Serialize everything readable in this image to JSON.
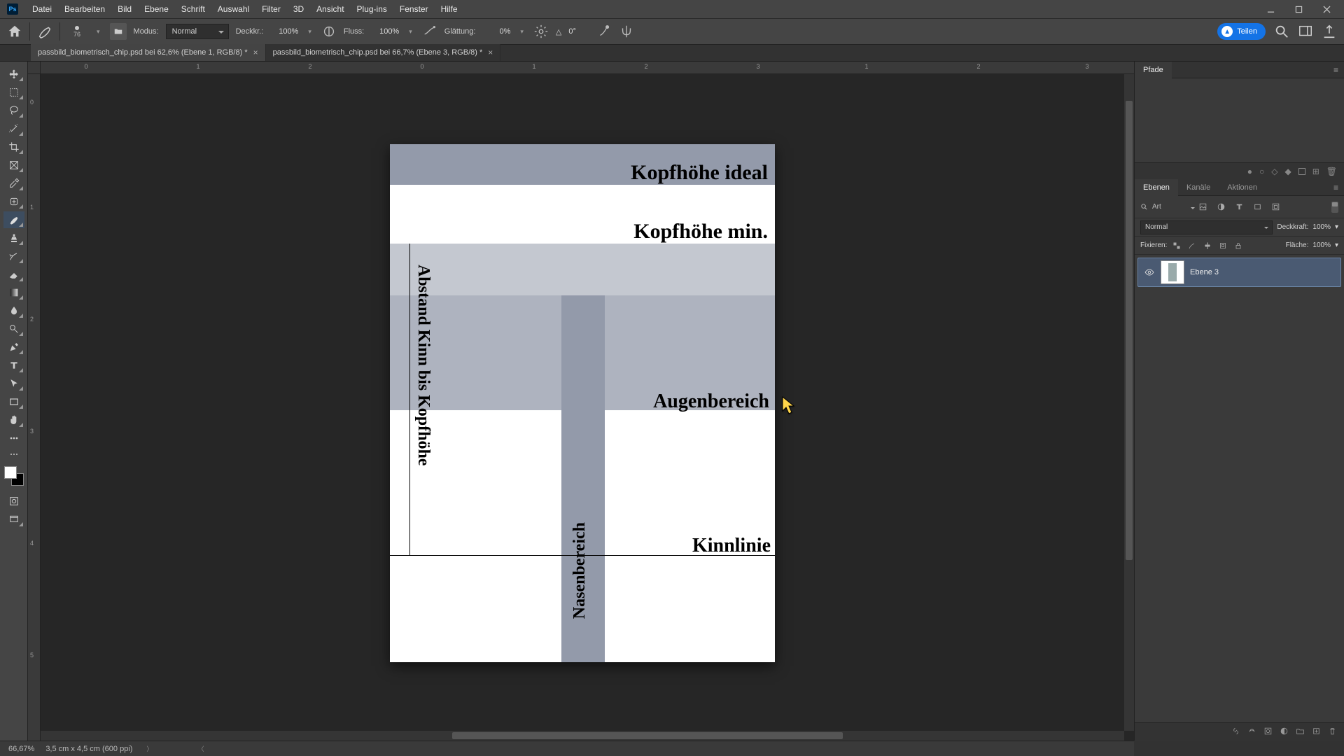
{
  "menu": {
    "items": [
      "Datei",
      "Bearbeiten",
      "Bild",
      "Ebene",
      "Schrift",
      "Auswahl",
      "Filter",
      "3D",
      "Ansicht",
      "Plug-ins",
      "Fenster",
      "Hilfe"
    ]
  },
  "options": {
    "brush_size": "76",
    "mode_label": "Modus:",
    "mode_value": "Normal",
    "opacity_label": "Deckkr.:",
    "opacity_value": "100%",
    "flow_label": "Fluss:",
    "flow_value": "100%",
    "smoothing_label": "Glättung:",
    "smoothing_value": "0%",
    "angle_icon_label": "△",
    "angle_value": "0°",
    "share_label": "Teilen"
  },
  "tabs": [
    {
      "title": "passbild_biometrisch_chip.psd bei 62,6% (Ebene 1, RGB/8) *",
      "active": false
    },
    {
      "title": "passbild_biometrisch_chip.psd bei 66,7% (Ebene 3, RGB/8) *",
      "active": true
    }
  ],
  "ruler_h": [
    {
      "pos": 65,
      "label": "0"
    },
    {
      "pos": 225,
      "label": "1"
    },
    {
      "pos": 385,
      "label": "2"
    },
    {
      "pos": 545,
      "label": "0"
    },
    {
      "pos": 705,
      "label": "1"
    },
    {
      "pos": 865,
      "label": "2"
    },
    {
      "pos": 1025,
      "label": "3"
    },
    {
      "pos": 1180,
      "label": "1"
    },
    {
      "pos": 1340,
      "label": "2"
    },
    {
      "pos": 1495,
      "label": "3"
    }
  ],
  "ruler_v": [
    {
      "pos": 40,
      "label": "0"
    },
    {
      "pos": 190,
      "label": "1"
    },
    {
      "pos": 350,
      "label": "2"
    },
    {
      "pos": 510,
      "label": "3"
    },
    {
      "pos": 670,
      "label": "4"
    },
    {
      "pos": 830,
      "label": "5"
    }
  ],
  "doc": {
    "kopfhoehe_ideal": "Kopfhöhe ideal",
    "kopfhoehe_min": "Kopfhöhe min.",
    "augenbereich": "Augenbereich",
    "kinnlinie": "Kinnlinie",
    "nasenbereich": "Nasenbereich",
    "abstand": "Abstand Kinn bis Kopfhöhe"
  },
  "panels": {
    "pfade_tab": "Pfade",
    "ebenen_tab": "Ebenen",
    "kanaele_tab": "Kanäle",
    "aktionen_tab": "Aktionen",
    "filter_search": "Art",
    "blend_mode": "Normal",
    "opacity_label": "Deckkraft:",
    "opacity_value": "100%",
    "lock_label": "Fixieren:",
    "fill_label": "Fläche:",
    "fill_value": "100%",
    "layer_0_name": "Ebene 3"
  },
  "status": {
    "zoom": "66,67%",
    "docinfo": "3,5 cm x 4,5 cm (600 ppi)"
  }
}
